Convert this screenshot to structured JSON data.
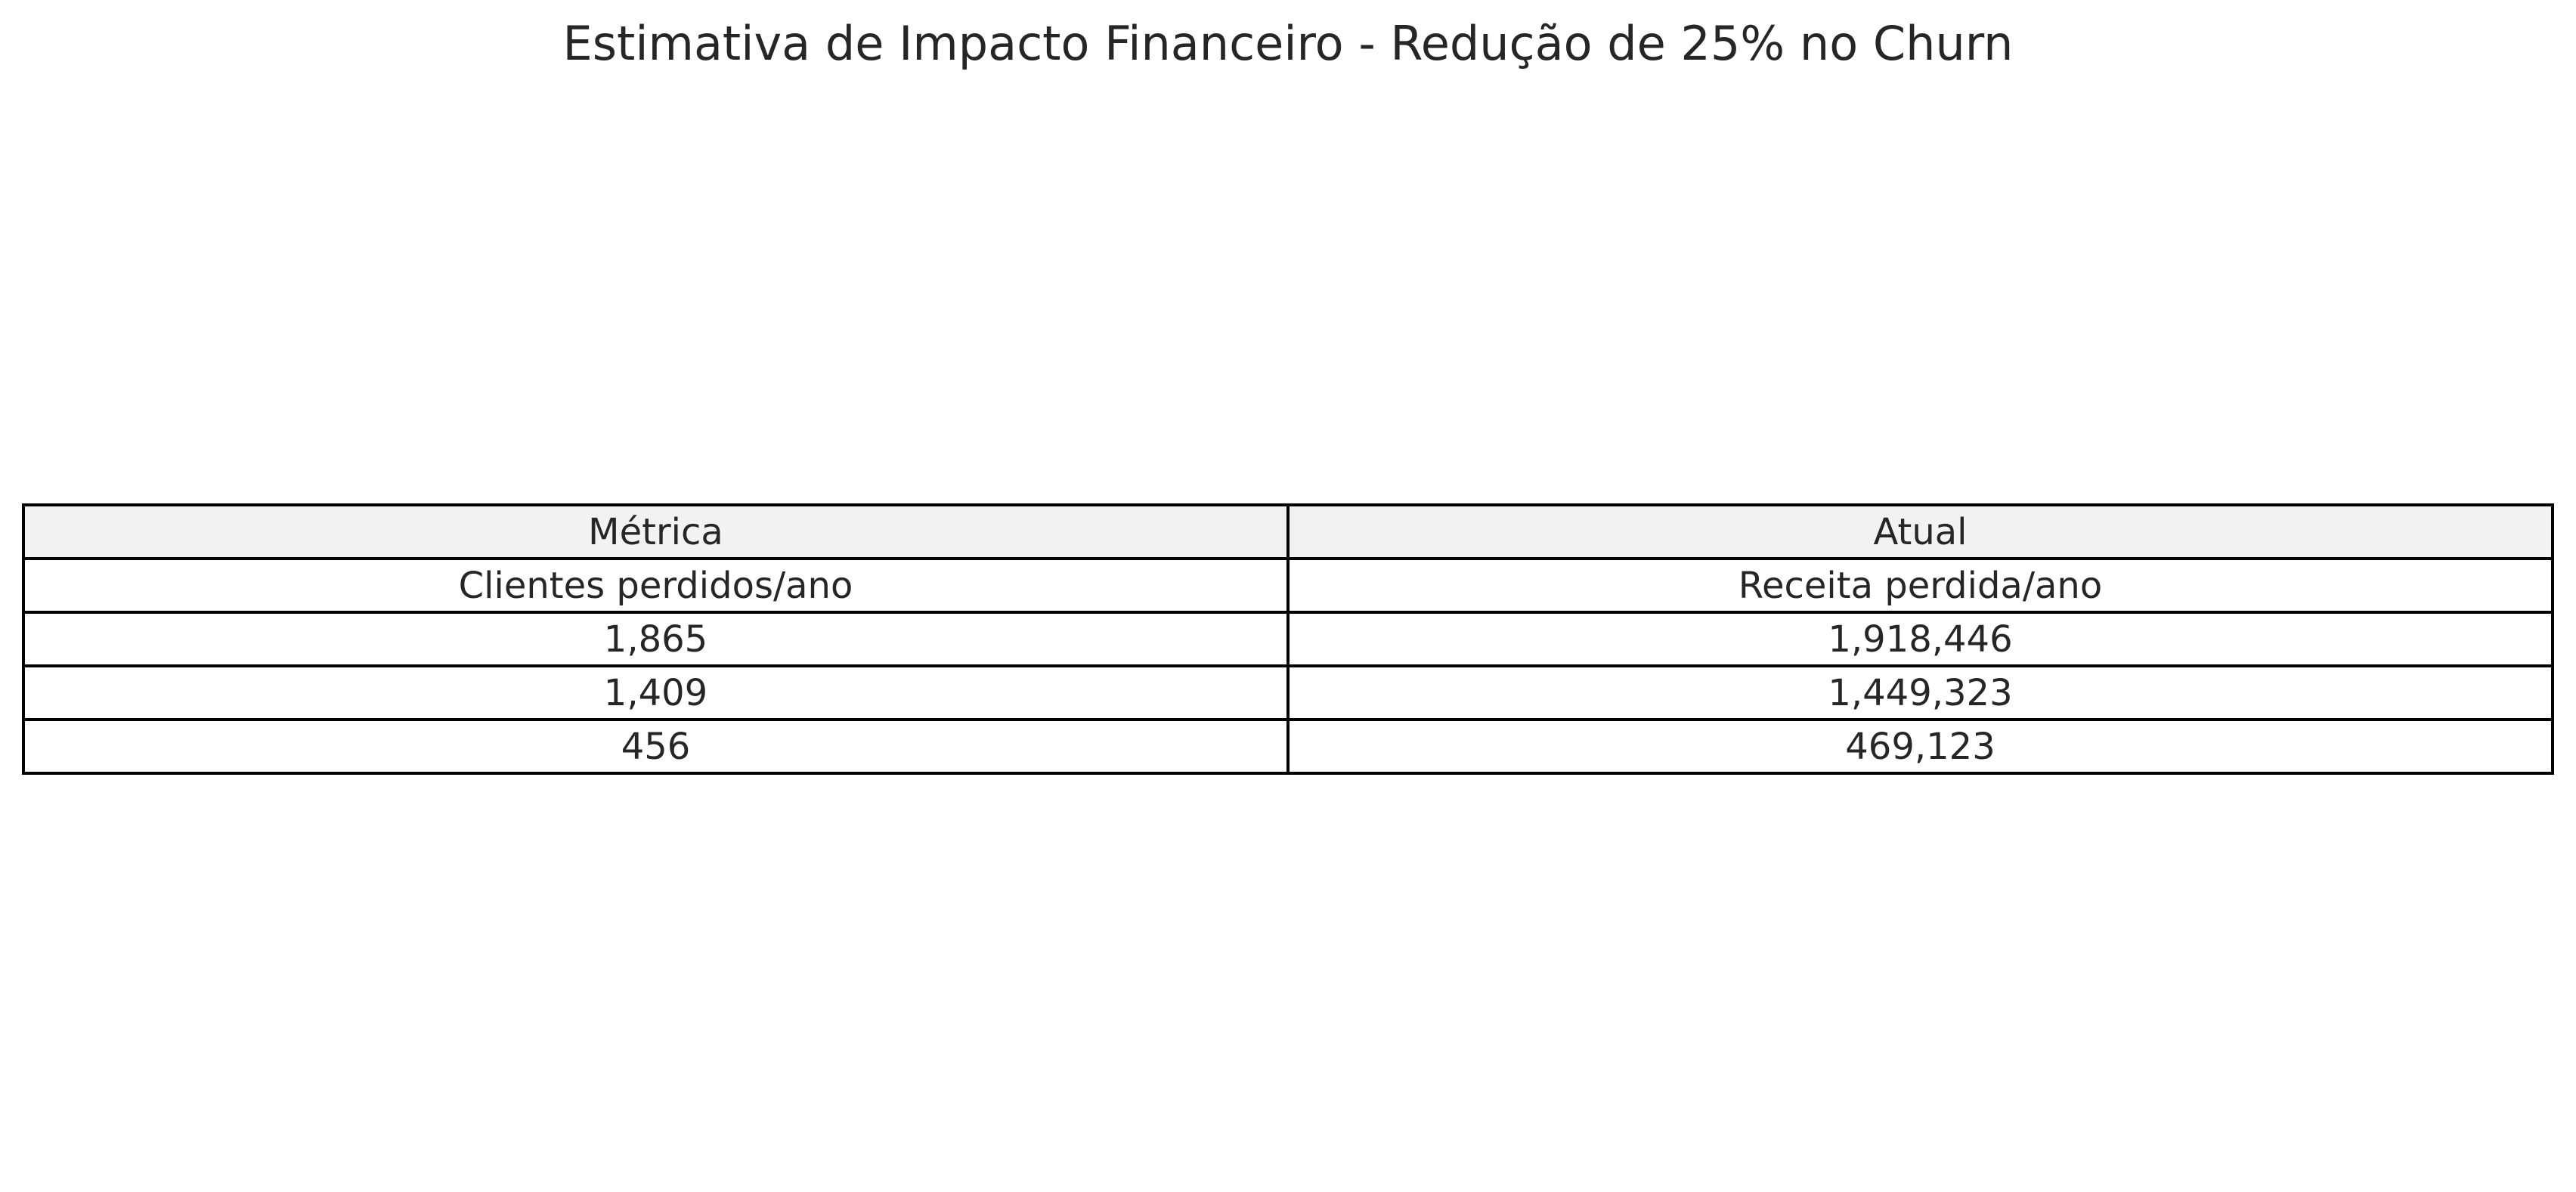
{
  "chart_data": {
    "type": "table",
    "title": "Estimativa de Impacto Financeiro - Redução de 25% no Churn",
    "columns": [
      "Métrica",
      "Atual"
    ],
    "rows": [
      [
        "Clientes perdidos/ano",
        "Receita perdida/ano"
      ],
      [
        "1,865",
        "1,918,446"
      ],
      [
        "1,409",
        "1,449,323"
      ],
      [
        "456",
        "469,123"
      ]
    ],
    "header_color": "#f2f2f2",
    "border_color": "#000000"
  }
}
